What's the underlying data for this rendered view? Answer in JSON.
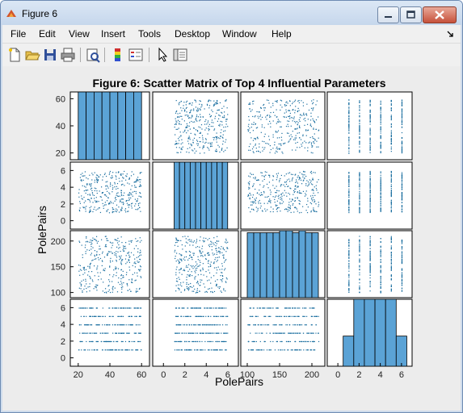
{
  "window": {
    "title": "Figure 6"
  },
  "menu": [
    "File",
    "Edit",
    "View",
    "Insert",
    "Tools",
    "Desktop",
    "Window",
    "Help"
  ],
  "toolbar_icons": [
    "new-figure-icon",
    "open-file-icon",
    "save-icon",
    "print-icon",
    "print-preview-icon",
    "colorbar-icon",
    "legend-icon",
    "pointer-icon",
    "property-editor-icon"
  ],
  "colors": {
    "bar_fill": "#5ba3d6",
    "scatter": "#1a6e9f"
  },
  "chart_data": {
    "type": "scatter",
    "title": "Figure 6: Scatter Matrix of Top 4 Influential Parameters",
    "xlabel": "PolePairs",
    "ylabel": "PolePairs",
    "grid": false,
    "variables": [
      {
        "range": [
          15,
          65
        ],
        "ticks": [
          20,
          40,
          60
        ],
        "yticks": [
          20,
          40,
          60
        ],
        "distribution": "uniform-continuous",
        "min": 20,
        "max": 60
      },
      {
        "range": [
          -1,
          7
        ],
        "ticks": [
          0,
          2,
          4,
          6
        ],
        "yticks": [
          0,
          2,
          4,
          6
        ],
        "distribution": "uniform-continuous",
        "min": 1,
        "max": 6
      },
      {
        "range": [
          90,
          220
        ],
        "ticks": [
          100,
          150,
          200
        ],
        "yticks": [
          100,
          150,
          200
        ],
        "distribution": "uniform-continuous",
        "min": 100,
        "max": 210
      },
      {
        "range": [
          -1,
          7
        ],
        "ticks": [
          0,
          2,
          4,
          6
        ],
        "yticks": [
          0,
          2,
          4,
          6
        ],
        "distribution": "discrete",
        "levels": [
          1,
          2,
          3,
          4,
          5,
          6
        ]
      }
    ],
    "histograms": [
      {
        "edges": [
          20,
          25,
          30,
          35,
          40,
          45,
          50,
          55,
          60
        ],
        "counts": [
          1,
          1,
          1,
          1,
          1,
          1,
          1,
          1
        ]
      },
      {
        "edges": [
          1,
          1.5,
          2,
          2.5,
          3,
          3.5,
          4,
          4.5,
          5,
          5.5,
          6
        ],
        "counts": [
          1,
          1,
          1,
          1,
          1,
          1,
          1,
          1,
          1,
          1
        ]
      },
      {
        "edges": [
          100,
          110,
          120,
          130,
          140,
          150,
          160,
          170,
          180,
          190,
          200,
          210
        ],
        "counts": [
          0.97,
          0.97,
          0.97,
          0.97,
          0.97,
          1,
          1,
          0.97,
          1,
          0.97,
          0.97
        ]
      },
      {
        "edges": [
          0.5,
          1.5,
          2.5,
          3.5,
          4.5,
          5.5,
          6.5
        ],
        "counts": [
          0.45,
          1,
          1,
          1,
          1,
          0.45
        ]
      }
    ],
    "points_per_panel": 350
  }
}
